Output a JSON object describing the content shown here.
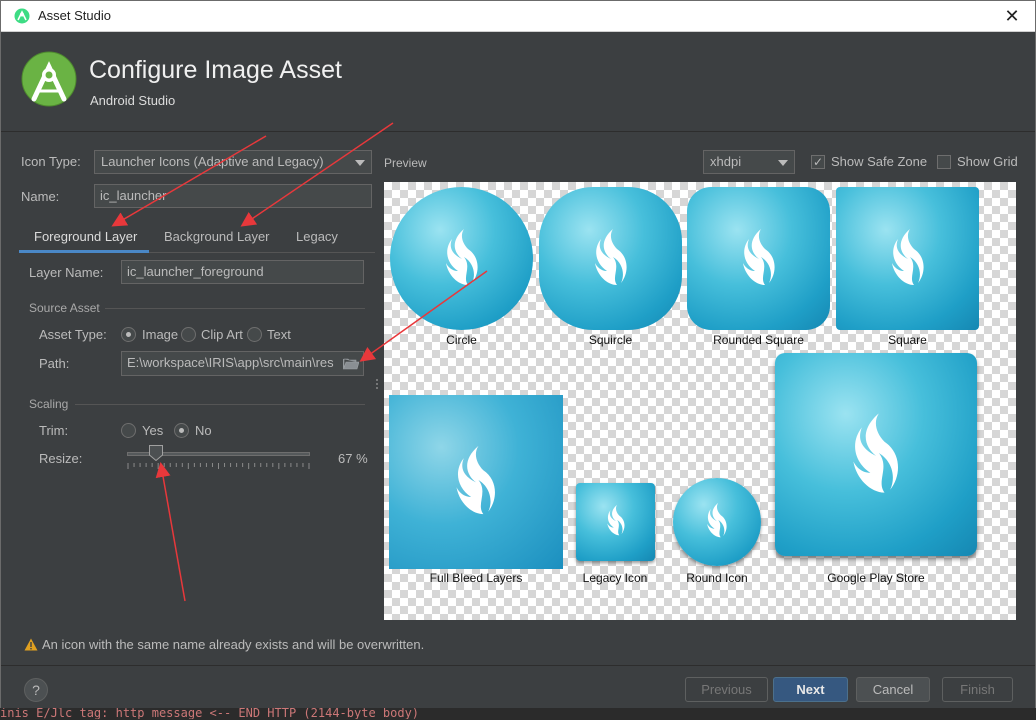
{
  "window": {
    "title": "Asset Studio",
    "close_symbol": "✕"
  },
  "header": {
    "title": "Configure Image Asset",
    "subtitle": "Android Studio"
  },
  "form": {
    "icon_type_label": "Icon Type:",
    "icon_type_value": "Launcher Icons (Adaptive and Legacy)",
    "name_label": "Name:",
    "name_value": "ic_launcher",
    "tabs": [
      {
        "label": "Foreground Layer",
        "selected": true
      },
      {
        "label": "Background Layer",
        "selected": false
      },
      {
        "label": "Legacy",
        "selected": false
      }
    ],
    "layer_name_label": "Layer Name:",
    "layer_name_value": "ic_launcher_foreground",
    "source_asset_title": "Source Asset",
    "asset_type_label": "Asset Type:",
    "asset_type_options": [
      {
        "label": "Image",
        "selected": true
      },
      {
        "label": "Clip Art",
        "selected": false
      },
      {
        "label": "Text",
        "selected": false
      }
    ],
    "path_label": "Path:",
    "path_value": "E:\\workspace\\IRIS\\app\\src\\main\\res",
    "scaling_title": "Scaling",
    "trim_label": "Trim:",
    "trim_options": [
      {
        "label": "Yes",
        "selected": false
      },
      {
        "label": "No",
        "selected": true
      }
    ],
    "resize_label": "Resize:",
    "resize_value_text": "67 %",
    "resize_value": 0.67
  },
  "preview": {
    "label": "Preview",
    "density": "xhdpi",
    "show_safe_zone_label": "Show Safe Zone",
    "show_safe_zone_checked": true,
    "show_grid_label": "Show Grid",
    "show_grid_checked": false,
    "captions": {
      "circle": "Circle",
      "squircle": "Squircle",
      "rounded_square": "Rounded Square",
      "square": "Square",
      "full_bleed": "Full Bleed Layers",
      "legacy": "Legacy Icon",
      "round": "Round Icon",
      "play_store": "Google Play Store"
    }
  },
  "warning": {
    "text": "An icon with the same name already exists and will be overwritten."
  },
  "buttons": {
    "help": "?",
    "previous": "Previous",
    "next": "Next",
    "cancel": "Cancel",
    "finish": "Finish"
  },
  "background_log": "inis E/Jlc tag: http message <-- END HTTP (2144-byte body)",
  "colors": {
    "accent": "#4a88c7",
    "annotation_arrow": "#e8383b",
    "icon_bg": "#2aa6cf"
  }
}
